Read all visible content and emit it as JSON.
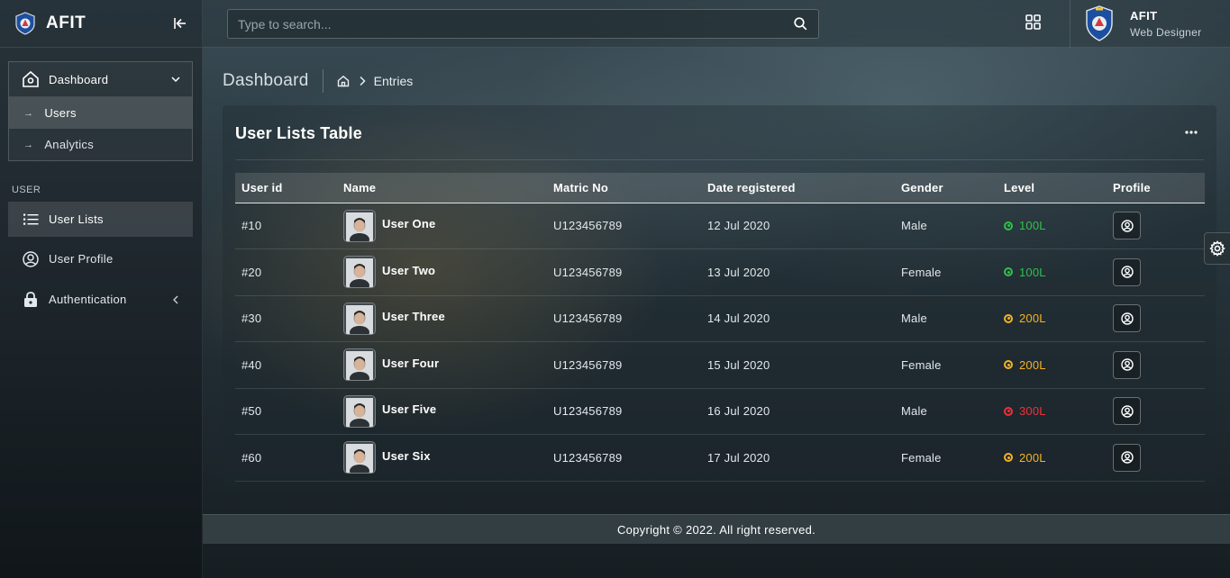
{
  "brand": {
    "name": "AFIT",
    "logo_icon": "afit-crest-icon"
  },
  "sidebar": {
    "dashboard_group": {
      "label": "Dashboard",
      "items": [
        {
          "label": "Users",
          "active": true
        },
        {
          "label": "Analytics",
          "active": false
        }
      ]
    },
    "section_label": "USER",
    "nav": [
      {
        "label": "User Lists",
        "icon": "list-icon",
        "active": true
      },
      {
        "label": "User Profile",
        "icon": "user-circle-icon",
        "active": false
      },
      {
        "label": "Authentication",
        "icon": "lock-icon",
        "active": false
      }
    ]
  },
  "topbar": {
    "search_placeholder": "Type to search...",
    "user": {
      "name": "AFIT",
      "role": "Web Designer"
    }
  },
  "page": {
    "title": "Dashboard",
    "breadcrumb": {
      "current": "Entries"
    }
  },
  "card": {
    "title": "User Lists Table",
    "columns": [
      "User id",
      "Name",
      "Matric No",
      "Date registered",
      "Gender",
      "Level",
      "Profile"
    ],
    "rows": [
      {
        "id": "#10",
        "name": "User One",
        "matric": "U123456789",
        "date": "12 Jul 2020",
        "gender": "Male",
        "level": "100L",
        "level_color": "#2ec24a"
      },
      {
        "id": "#20",
        "name": "User Two",
        "matric": "U123456789",
        "date": "13 Jul 2020",
        "gender": "Female",
        "level": "100L",
        "level_color": "#2ec24a"
      },
      {
        "id": "#30",
        "name": "User Three",
        "matric": "U123456789",
        "date": "14 Jul 2020",
        "gender": "Male",
        "level": "200L",
        "level_color": "#f5b323"
      },
      {
        "id": "#40",
        "name": "User Four",
        "matric": "U123456789",
        "date": "15 Jul 2020",
        "gender": "Female",
        "level": "200L",
        "level_color": "#f5b323"
      },
      {
        "id": "#50",
        "name": "User Five",
        "matric": "U123456789",
        "date": "16 Jul 2020",
        "gender": "Male",
        "level": "300L",
        "level_color": "#f0303a"
      },
      {
        "id": "#60",
        "name": "User Six",
        "matric": "U123456789",
        "date": "17 Jul 2020",
        "gender": "Female",
        "level": "200L",
        "level_color": "#f5b323"
      }
    ]
  },
  "footer": {
    "text": "Copyright © 2022. All right reserved."
  }
}
